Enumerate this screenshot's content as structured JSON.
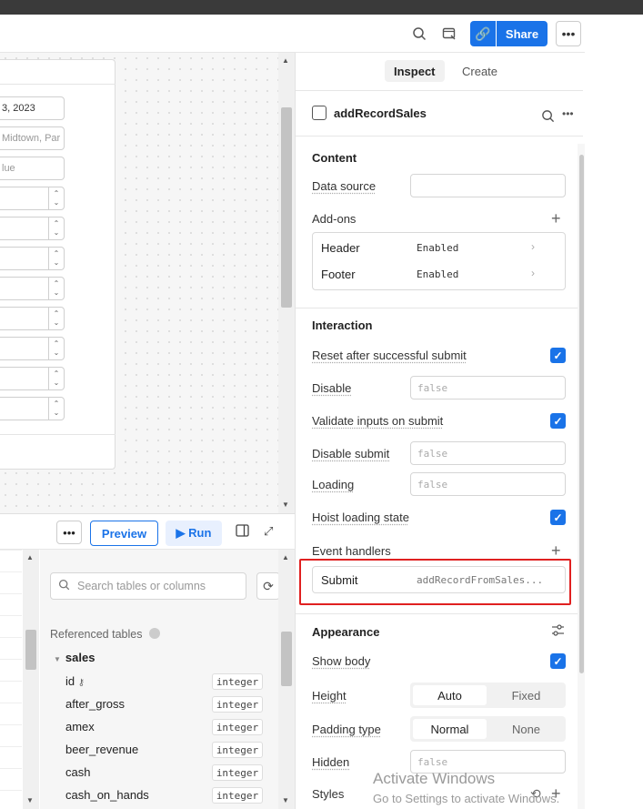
{
  "toolbar": {
    "share_label": "Share",
    "icons": [
      "search-icon",
      "preview-window-icon",
      "link-icon",
      "more-icon"
    ]
  },
  "canvas_form": {
    "date_value": "3, 2023",
    "address_placeholder": "Midtown, Par",
    "value_placeholder": "lue"
  },
  "query_panel": {
    "more_label": "•••",
    "preview_label": "Preview",
    "run_label": "▶ Run",
    "search_placeholder": "Search tables or columns",
    "referenced_tables_label": "Referenced tables",
    "table_name": "sales",
    "columns": [
      {
        "name": "id",
        "type": "integer"
      },
      {
        "name": "after_gross",
        "type": "integer"
      },
      {
        "name": "amex",
        "type": "integer"
      },
      {
        "name": "beer_revenue",
        "type": "integer"
      },
      {
        "name": "cash",
        "type": "integer"
      },
      {
        "name": "cash_on_hands",
        "type": "integer"
      }
    ]
  },
  "inspector": {
    "tabs": [
      {
        "label": "Inspect",
        "active": true
      },
      {
        "label": "Create",
        "active": false
      }
    ],
    "component_name": "addRecordSales",
    "content": {
      "title": "Content",
      "data_source_label": "Data source",
      "data_source_value": "",
      "addons_label": "Add-ons",
      "addons": [
        {
          "name": "Header",
          "value": "Enabled"
        },
        {
          "name": "Footer",
          "value": "Enabled"
        }
      ]
    },
    "interaction": {
      "title": "Interaction",
      "reset_label": "Reset after successful submit",
      "reset_checked": true,
      "disable_label": "Disable",
      "disable_value": "false",
      "validate_label": "Validate inputs on submit",
      "validate_checked": true,
      "disable_submit_label": "Disable submit",
      "disable_submit_value": "false",
      "loading_label": "Loading",
      "loading_value": "false",
      "hoist_label": "Hoist loading state",
      "hoist_checked": true,
      "event_handlers_label": "Event handlers",
      "handler_event": "Submit",
      "handler_action": "addRecordFromSales..."
    },
    "appearance": {
      "title": "Appearance",
      "show_body_label": "Show body",
      "show_body_checked": true,
      "height_label": "Height",
      "height_options": [
        "Auto",
        "Fixed"
      ],
      "height_selected": "Auto",
      "padding_label": "Padding type",
      "padding_options": [
        "Normal",
        "None"
      ],
      "padding_selected": "Normal",
      "hidden_label": "Hidden",
      "hidden_value": "false",
      "styles_label": "Styles"
    }
  },
  "watermark": {
    "line1": "Activate Windows",
    "line2": "Go to Settings to activate Windows."
  },
  "colors": {
    "accent": "#1a73e8",
    "highlight": "#e02020"
  }
}
